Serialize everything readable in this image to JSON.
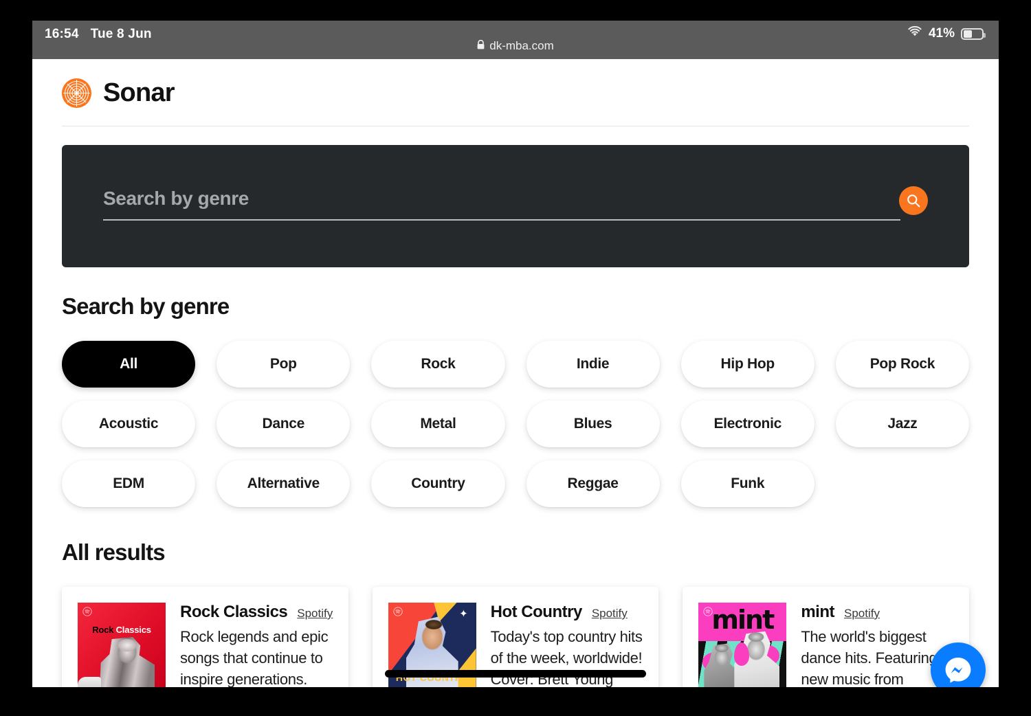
{
  "status_bar": {
    "time": "16:54",
    "date": "Tue 8 Jun",
    "url": "dk-mba.com",
    "lock_icon": "lock-icon",
    "wifi_icon": "wifi-icon",
    "battery_percent": "41%",
    "battery_icon": "battery-icon",
    "battery_level": 41,
    "background_color": "#5b5b5b"
  },
  "header": {
    "brand": "Sonar",
    "logo_icon": "sonar-radar-logo-icon",
    "accent_color": "#f9761e"
  },
  "search": {
    "placeholder": "Search by genre",
    "value": "",
    "button_icon": "search-icon",
    "panel_color": "#26292b",
    "button_color": "#f9761e"
  },
  "genre_section": {
    "title": "Search by genre",
    "active": "All",
    "chips": [
      "All",
      "Pop",
      "Rock",
      "Indie",
      "Hip Hop",
      "Pop Rock",
      "Acoustic",
      "Dance",
      "Metal",
      "Blues",
      "Electronic",
      "Jazz",
      "EDM",
      "Alternative",
      "Country",
      "Reggae",
      "Funk"
    ]
  },
  "results_section": {
    "title": "All results",
    "cards": [
      {
        "title": "Rock Classics",
        "source": "Spotify",
        "description": "Rock legends and epic songs that continue to inspire generations.",
        "art_label_dark": "Rock",
        "art_label_light": "Classics",
        "art_primary_color": "#e00e28",
        "spotify_icon": "spotify-icon"
      },
      {
        "title": "Hot Country",
        "source": "Spotify",
        "description": "Today's top country hits of the week, worldwide! Cover: Brett Young",
        "art_label": "HOT COUNTRY",
        "art_primary_color": "#1d2a5c",
        "spotify_icon": "spotify-icon"
      },
      {
        "title": "mint",
        "source": "Spotify",
        "description": "The world's biggest dance hits. Featuring new music from Calvin...",
        "art_label": "mint",
        "art_primary_color": "#fb3dbf",
        "spotify_icon": "spotify-icon"
      }
    ]
  },
  "floating_action": {
    "icon": "messenger-icon",
    "color": "#0a7cff"
  }
}
